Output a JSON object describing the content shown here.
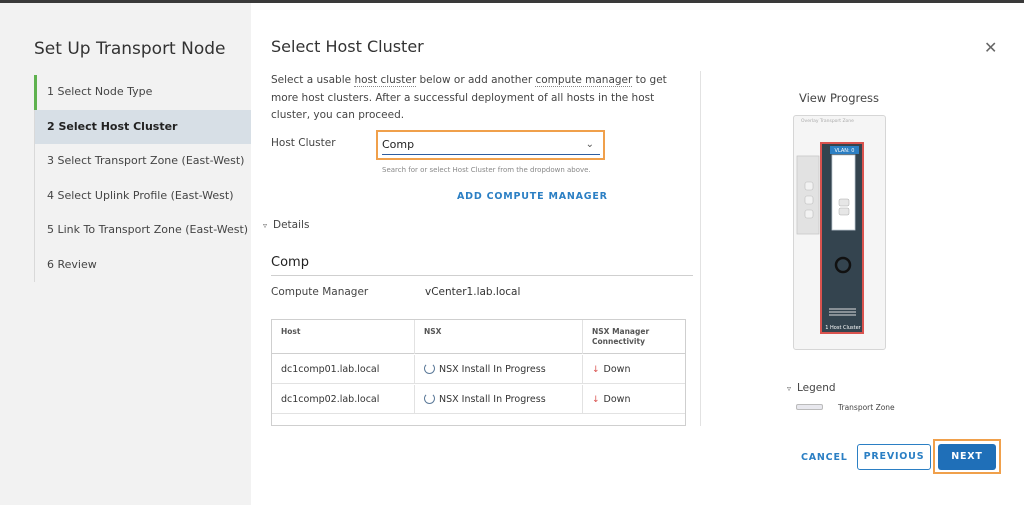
{
  "sidebar": {
    "title": "Set Up Transport Node",
    "steps": [
      {
        "label": "1  Select Node Type"
      },
      {
        "label": "2  Select Host Cluster"
      },
      {
        "label": "3  Select Transport Zone (East-West)"
      },
      {
        "label": "4  Select Uplink Profile (East-West)"
      },
      {
        "label": "5  Link To Transport Zone (East-West)"
      },
      {
        "label": "6  Review"
      }
    ]
  },
  "main": {
    "title": "Select Host Cluster",
    "close_icon": "close-icon",
    "description": {
      "part1": "Select a usable ",
      "link1": "host cluster",
      "part2": " below or add another ",
      "link2": "compute manager",
      "part3": " to get more host clusters. After a successful deployment of all hosts in the host cluster, you can proceed."
    },
    "host_cluster": {
      "label": "Host Cluster",
      "value": "Comp",
      "hint": "Search for or select Host Cluster from the dropdown above."
    },
    "add_compute_manager": "ADD COMPUTE MANAGER",
    "details_label": "Details",
    "section_title": "Comp",
    "compute_manager": {
      "label": "Compute Manager",
      "value": "vCenter1.lab.local"
    },
    "table": {
      "headers": [
        "Host",
        "NSX",
        "NSX Manager Connectivity"
      ],
      "rows": [
        {
          "host": "dc1comp01.lab.local",
          "nsx": "NSX Install In Progress",
          "conn": "Down"
        },
        {
          "host": "dc1comp02.lab.local",
          "nsx": "NSX Install In Progress",
          "conn": "Down"
        }
      ]
    }
  },
  "view_progress": {
    "title": "View Progress",
    "overlay_label": "Overlay Transport Zone",
    "vlan_label": "VLAN: 0",
    "cluster_label": "1 Host Cluster",
    "legend_label": "Legend",
    "legend_items": [
      {
        "label": "Transport Zone"
      }
    ]
  },
  "footer": {
    "cancel": "CANCEL",
    "previous": "PREVIOUS",
    "next": "NEXT"
  },
  "colors": {
    "accent": "#2b7fc4",
    "primary_button": "#1f6fb8",
    "highlight": "#f0a04b",
    "done_step": "#5fb24f",
    "down": "#d9534f"
  }
}
